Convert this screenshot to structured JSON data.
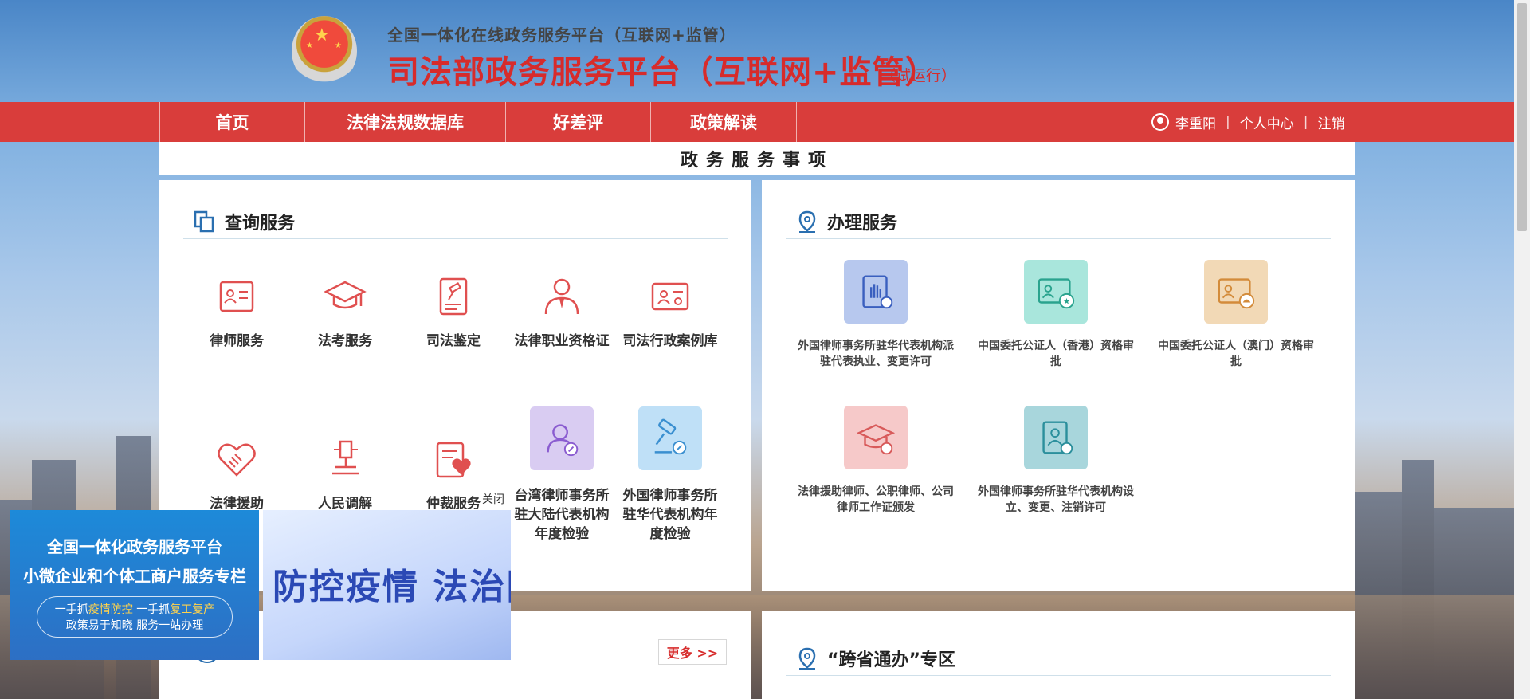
{
  "header": {
    "subtitle": "全国一体化在线政务服务平台（互联网+监管）",
    "title": "司法部政务服务平台（互联网+监管）",
    "trial": "（试运行）"
  },
  "nav": {
    "items": [
      {
        "label": "首页"
      },
      {
        "label": "法律法规数据库"
      },
      {
        "label": "好差评"
      },
      {
        "label": "政策解读"
      }
    ],
    "user_name": "李重阳",
    "personal_center": "个人中心",
    "logout": "注销",
    "separator": "|"
  },
  "section_title": "政务服务事项",
  "query_panel": {
    "title": "查询服务",
    "items": [
      {
        "label": "律师服务",
        "icon": "lawyer-card-icon"
      },
      {
        "label": "法考服务",
        "icon": "graduation-cap-icon"
      },
      {
        "label": "司法鉴定",
        "icon": "document-gavel-icon"
      },
      {
        "label": "法律职业资格证",
        "icon": "person-tie-icon"
      },
      {
        "label": "司法行政案例库",
        "icon": "case-card-icon"
      },
      {
        "label": "法律援助",
        "icon": "handshake-heart-icon"
      },
      {
        "label": "人民调解",
        "icon": "gavel-icon"
      },
      {
        "label": "仲裁服务",
        "icon": "clipboard-heart-icon"
      },
      {
        "label": "台湾律师事务所驻大陆代表机构年度检验",
        "icon": "person-pen-icon"
      },
      {
        "label": "外国律师事务所驻华代表机构年度检验",
        "icon": "gavel-check-icon"
      }
    ]
  },
  "handle_panel": {
    "title": "办理服务",
    "items": [
      {
        "label": "外国律师事务所驻华代表机构派驻代表执业、变更许可",
        "icon": "hand-book-icon",
        "color": "#b7c8ee"
      },
      {
        "label": "中国委托公证人（香港）资格审批",
        "icon": "id-card-star-icon",
        "color": "#a9e6dc"
      },
      {
        "label": "中国委托公证人（澳门）资格审批",
        "icon": "id-card-lotus-icon",
        "color": "#f2d9b6"
      },
      {
        "label": "法律援助律师、公职律师、公司律师工作证颁发",
        "icon": "cap-certificate-icon",
        "color": "#f6c9c9"
      },
      {
        "label": "外国律师事务所驻华代表机构设立、变更、注销许可",
        "icon": "book-person-icon",
        "color": "#a8d6dc"
      }
    ]
  },
  "bottom": {
    "more_label": "更多 >>",
    "cross_province_title": "“跨省通办”专区"
  },
  "ads": {
    "ad1_line1": "全国一体化政务服务平台",
    "ad1_line2": "小微企业和个体工商户服务专栏",
    "ad1_pill_a": "一手抓",
    "ad1_pill_b": "疫情防控",
    "ad1_pill_c": " 一手抓",
    "ad1_pill_d": "复工复产",
    "ad1_pill_line2": "政策易于知晓 服务一站办理",
    "ad2_text": "防控疫情  法治同行",
    "close_label": "关闭"
  },
  "colors": {
    "brand_red": "#d93d3b",
    "title_red": "#d72b2b"
  }
}
